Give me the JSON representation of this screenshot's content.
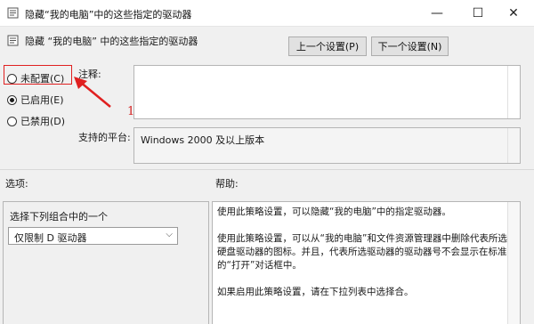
{
  "window": {
    "title": "隐藏“我的电脑”中的这些指定的驱动器",
    "minimize_glyph": "—",
    "maximize_glyph": "☐",
    "close_glyph": "✕"
  },
  "header": {
    "title": "隐藏 “我的电脑” 中的这些指定的驱动器",
    "icon": "policy-document-icon"
  },
  "nav": {
    "prev_label": "上一个设置(P)",
    "next_label": "下一个设置(N)"
  },
  "state": {
    "options": [
      {
        "label": "未配置(C)",
        "selected": false
      },
      {
        "label": "已启用(E)",
        "selected": true
      },
      {
        "label": "已禁用(D)",
        "selected": false
      }
    ]
  },
  "labels": {
    "comment": "注释:",
    "platform": "支持的平台:",
    "options": "选项:",
    "help": "帮助:"
  },
  "annotation": {
    "number": "1",
    "color": "#e02020"
  },
  "platform_value": "Windows 2000 及以上版本",
  "options_pane": {
    "label": "选择下列组合中的一个",
    "select_value": "仅限制 D 驱动器"
  },
  "help_text": [
    "使用此策略设置，可以隐藏“我的电脑”中的指定驱动器。",
    "使用此策略设置，可以从“我的电脑”和文件资源管理器中删除代表所选硬盘驱动器的图标。并且，代表所选驱动器的驱动器号不会显示在标准的“打开”对话框中。",
    "如果启用此策略设置，请在下拉列表中选择合。"
  ]
}
